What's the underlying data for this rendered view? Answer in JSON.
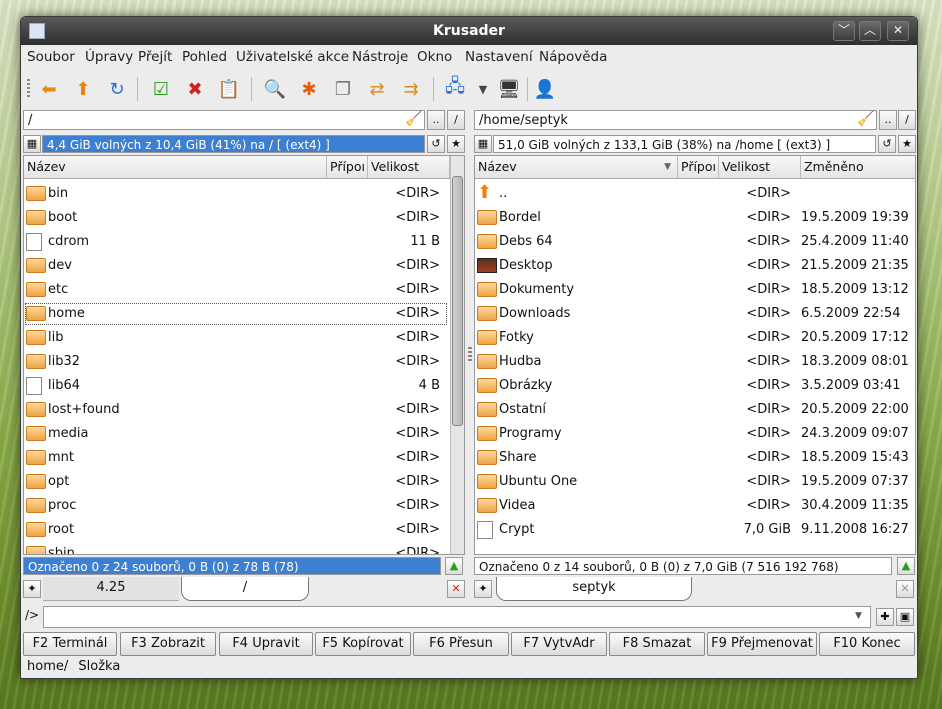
{
  "window": {
    "title": "Krusader"
  },
  "menu": [
    "Soubor",
    "Úpravy",
    "Přejít",
    "Pohled",
    "Uživatelské akce",
    "Nástroje",
    "Okno",
    "Nastavení",
    "Nápověda"
  ],
  "toolbar": {
    "icons": [
      "back-icon",
      "up-icon",
      "refresh-icon",
      "select-icon",
      "delete-icon",
      "compare-icon",
      "search-icon",
      "new-icon",
      "copy-icon",
      "swap-icon",
      "sync-icon",
      "network-icon",
      "terminal-icon",
      "root-icon"
    ]
  },
  "left": {
    "path": "/",
    "disk_info": "4,4 GiB volných z 10,4 GiB (41%) na / [ (ext4) ]",
    "columns": [
      "Název",
      "Přípoı",
      "Velikost"
    ],
    "rows": [
      {
        "name": "bin",
        "size": "<DIR>",
        "type": "dir"
      },
      {
        "name": "boot",
        "size": "<DIR>",
        "type": "dir"
      },
      {
        "name": "cdrom",
        "size": "11 B",
        "type": "link"
      },
      {
        "name": "dev",
        "size": "<DIR>",
        "type": "dir"
      },
      {
        "name": "etc",
        "size": "<DIR>",
        "type": "dir"
      },
      {
        "name": "home",
        "size": "<DIR>",
        "type": "dir"
      },
      {
        "name": "lib",
        "size": "<DIR>",
        "type": "dir"
      },
      {
        "name": "lib32",
        "size": "<DIR>",
        "type": "dir"
      },
      {
        "name": "lib64",
        "size": "4 B",
        "type": "link"
      },
      {
        "name": "lost+found",
        "size": "<DIR>",
        "type": "dir"
      },
      {
        "name": "media",
        "size": "<DIR>",
        "type": "dir"
      },
      {
        "name": "mnt",
        "size": "<DIR>",
        "type": "dir"
      },
      {
        "name": "opt",
        "size": "<DIR>",
        "type": "dir"
      },
      {
        "name": "proc",
        "size": "<DIR>",
        "type": "dir"
      },
      {
        "name": "root",
        "size": "<DIR>",
        "type": "dir"
      },
      {
        "name": "sbin",
        "size": "<DIR>",
        "type": "dir"
      }
    ],
    "status": "Označeno 0 z 24 souborů, 0 B  (0) z 78 B (78)",
    "tabs": [
      "4.25",
      "/"
    ]
  },
  "right": {
    "path": "/home/septyk",
    "disk_info": "51,0 GiB volných z 133,1 GiB (38%) na /home [ (ext3) ]",
    "columns": [
      "Název",
      "Přípoı",
      "Velikost",
      "Změněno"
    ],
    "rows": [
      {
        "name": "..",
        "size": "<DIR>",
        "date": "",
        "type": "up"
      },
      {
        "name": "Bordel",
        "size": "<DIR>",
        "date": "19.5.2009 19:39",
        "type": "dir"
      },
      {
        "name": "Debs 64",
        "size": "<DIR>",
        "date": "25.4.2009 11:40",
        "type": "dir"
      },
      {
        "name": "Desktop",
        "size": "<DIR>",
        "date": "21.5.2009 21:35",
        "type": "desktop"
      },
      {
        "name": "Dokumenty",
        "size": "<DIR>",
        "date": "18.5.2009 13:12",
        "type": "dir"
      },
      {
        "name": "Downloads",
        "size": "<DIR>",
        "date": "6.5.2009 22:54",
        "type": "dir"
      },
      {
        "name": "Fotky",
        "size": "<DIR>",
        "date": "20.5.2009 17:12",
        "type": "dir"
      },
      {
        "name": "Hudba",
        "size": "<DIR>",
        "date": "18.3.2009 08:01",
        "type": "dir"
      },
      {
        "name": "Obrázky",
        "size": "<DIR>",
        "date": "3.5.2009 03:41",
        "type": "dir"
      },
      {
        "name": "Ostatní",
        "size": "<DIR>",
        "date": "20.5.2009 22:00",
        "type": "dir"
      },
      {
        "name": "Programy",
        "size": "<DIR>",
        "date": "24.3.2009 09:07",
        "type": "dir"
      },
      {
        "name": "Share",
        "size": "<DIR>",
        "date": "18.5.2009 15:43",
        "type": "dir"
      },
      {
        "name": "Ubuntu One",
        "size": "<DIR>",
        "date": "19.5.2009 07:37",
        "type": "dir"
      },
      {
        "name": "Videa",
        "size": "<DIR>",
        "date": "30.4.2009 11:35",
        "type": "dir"
      },
      {
        "name": "Crypt",
        "size": "7,0 GiB",
        "date": "9.11.2008 16:27",
        "type": "file"
      }
    ],
    "status": "Označeno 0 z 14 souborů, 0 B  (0) z 7,0 GiB (7 516 192 768)",
    "tabs": [
      "septyk"
    ]
  },
  "cmdline": {
    "prompt": "/>",
    "value": ""
  },
  "fkeys": [
    "F2 Terminál",
    "F3 Zobrazit",
    "F4 Upravit",
    "F5 Kopírovat",
    "F6 Přesun",
    "F7 VytvAdr",
    "F8 Smazat",
    "F9 Přejmenovat",
    "F10 Konec"
  ],
  "bottom_status": {
    "path": "home/",
    "kind": "Složka"
  }
}
